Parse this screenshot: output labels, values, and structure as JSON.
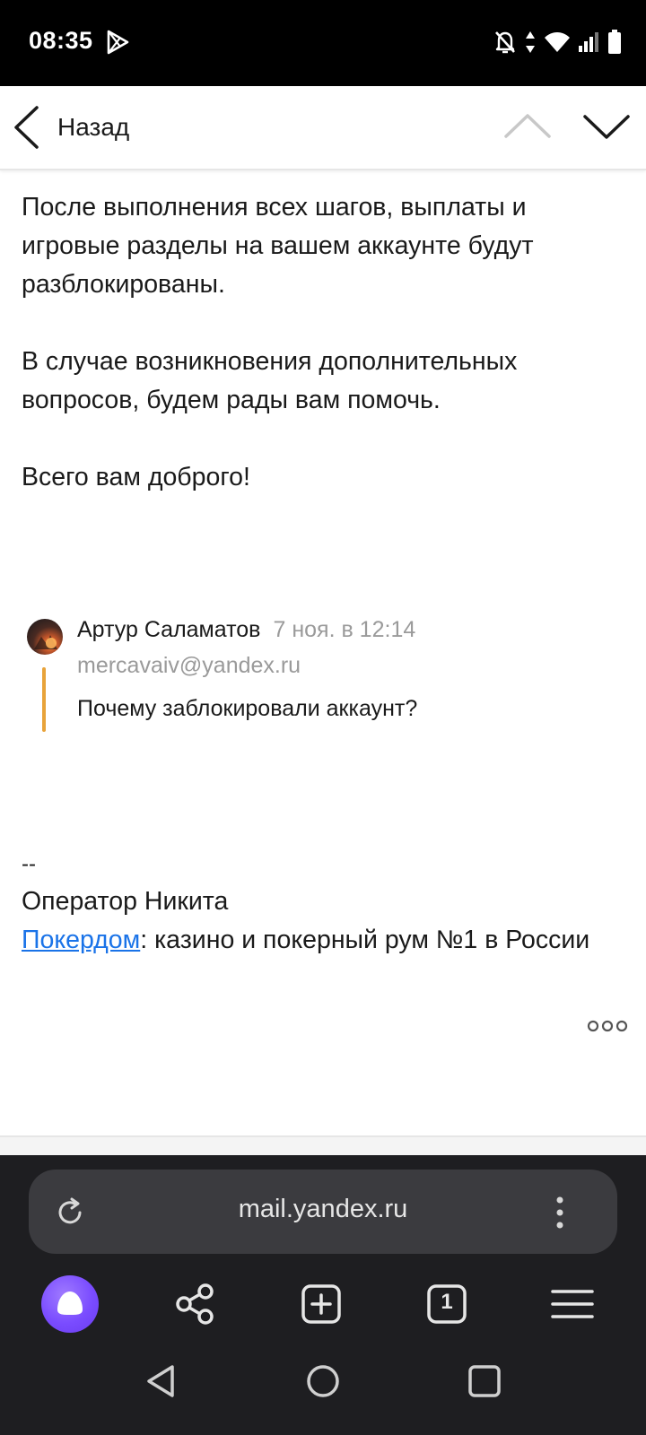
{
  "status_bar": {
    "time": "08:35",
    "icons": [
      "play-store-icon",
      "bell-off-icon",
      "data-arrows-icon",
      "wifi-icon",
      "signal-icon",
      "battery-icon"
    ]
  },
  "toolbar": {
    "back_label": "Назад",
    "icons": [
      "chevron-left-icon",
      "chevron-up-icon",
      "chevron-down-icon"
    ]
  },
  "message": {
    "paragraphs": [
      "После выполнения всех шагов, выплаты и игровые разделы на вашем аккаунте будут разблокированы.",
      "В случае возникновения дополнительных вопросов, будем рады вам помочь.",
      "Всего вам доброго!"
    ]
  },
  "quote": {
    "author": "Артур Саламатов",
    "date": "7 ноя. в 12:14",
    "email": "mercavaiv@yandex.ru",
    "text": "Почему заблокировали аккаунт?"
  },
  "signature": {
    "dashes": "--",
    "operator": "Оператор Никита",
    "link_text": "Покердом",
    "link_suffix": ": казино и покерный рум №1 в России"
  },
  "browser": {
    "url": "mail.yandex.ru",
    "tabs_count": "1"
  },
  "colors": {
    "accent_link": "#1a73e8",
    "quote_bar": "#e8a33a",
    "browser_bg": "#1e1e21",
    "alice_purple": "#7a4cff"
  }
}
